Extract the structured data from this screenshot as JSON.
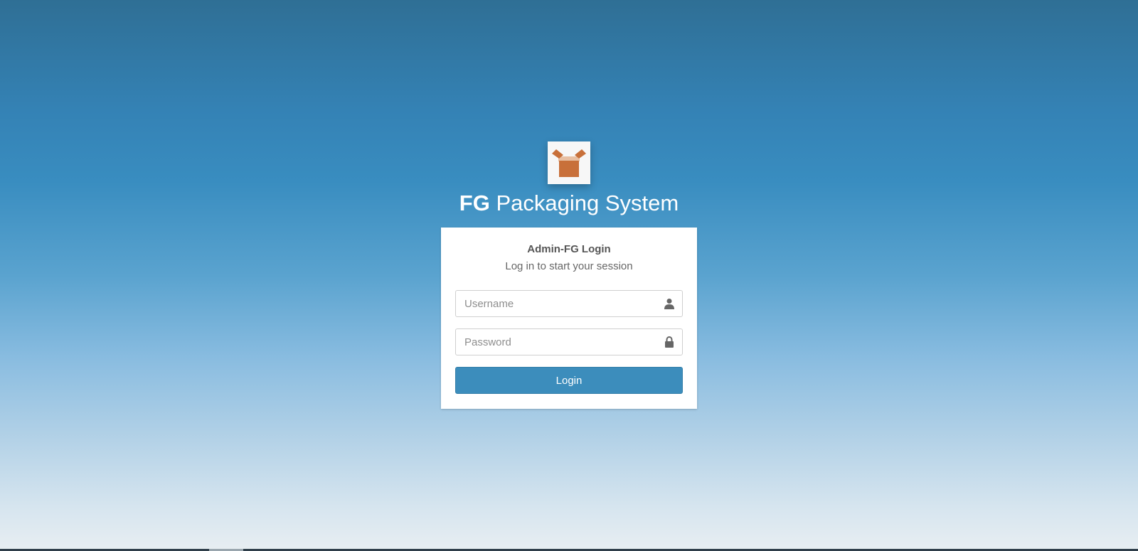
{
  "brand": {
    "bold": "FG",
    "rest": " Packaging System",
    "logo_icon": "open-box-icon",
    "logo_color": "#c8703a"
  },
  "login_card": {
    "title": "Admin-FG Login",
    "subtitle": "Log in to start your session",
    "username": {
      "placeholder": "Username",
      "value": "",
      "icon": "user-icon"
    },
    "password": {
      "placeholder": "Password",
      "value": "",
      "icon": "lock-icon"
    },
    "login_label": "Login",
    "button_color": "#3c8dbc"
  }
}
